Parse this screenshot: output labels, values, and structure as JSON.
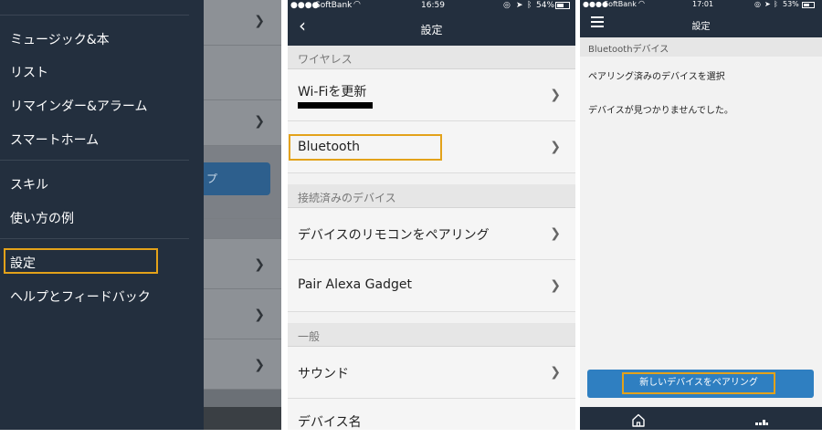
{
  "panel1": {
    "menu_items": [
      "ミュージック&本",
      "リスト",
      "リマインダー&アラーム",
      "スマートホーム",
      "スキル",
      "使い方の例",
      "設定",
      "ヘルプとフィードバック"
    ],
    "background_button_fragment": "プ"
  },
  "panel2": {
    "status": {
      "carrier": "SoftBank",
      "time": "16:59",
      "battery": "54%"
    },
    "nav_title": "設定",
    "section_wireless": "ワイヤレス",
    "row_wifi": "Wi-Fiを更新",
    "row_bluetooth": "Bluetooth",
    "section_connected": "接続済みのデバイス",
    "row_remote": "デバイスのリモコンをペアリング",
    "row_gadget": "Pair Alexa Gadget",
    "section_general": "一般",
    "row_sound": "サウンド",
    "row_device_name": "デバイス名"
  },
  "panel3": {
    "status": {
      "carrier": "SoftBank",
      "time": "17:01",
      "battery": "53%"
    },
    "nav_title": "設定",
    "section": "Bluetoothデバイス",
    "select_text": "ペアリング済みのデバイスを選択",
    "empty_text": "デバイスが見つかりませんでした。",
    "pair_button": "新しいデバイスをペアリング"
  },
  "colors": {
    "nav_dark": "#232f3e",
    "highlight": "#e3a21a",
    "primary_blue": "#2f7fc1"
  }
}
